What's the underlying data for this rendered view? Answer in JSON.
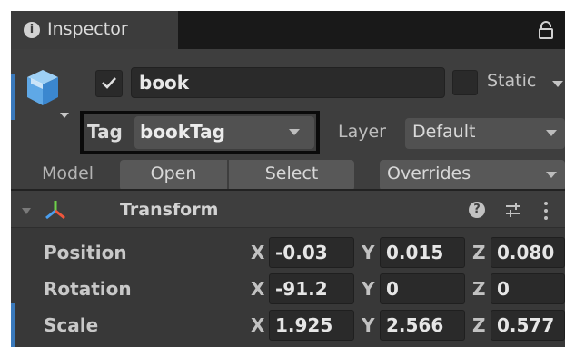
{
  "inspector_tab": {
    "label": "Inspector",
    "icon": "info-icon"
  },
  "header": {
    "active_checked": true,
    "object_name": "book",
    "static_label": "Static",
    "tag_label": "Tag",
    "tag_value": "bookTag",
    "layer_label": "Layer",
    "layer_value": "Default"
  },
  "model_row": {
    "label": "Model",
    "open_label": "Open",
    "select_label": "Select",
    "overrides_label": "Overrides"
  },
  "transform": {
    "title": "Transform",
    "help_glyph": "?",
    "rows": [
      {
        "label": "Position",
        "x": "-0.03",
        "y": "0.015",
        "z": "0.080"
      },
      {
        "label": "Rotation",
        "x": "-91.2",
        "y": "0",
        "z": "0"
      },
      {
        "label": "Scale",
        "x": "1.925",
        "y": "2.566",
        "z": "0.577"
      }
    ]
  },
  "axes": {
    "x": "X",
    "y": "Y",
    "z": "Z"
  },
  "colors": {
    "selection_blue": "#3a79bb",
    "highlight_border": "#0a0a0a"
  }
}
